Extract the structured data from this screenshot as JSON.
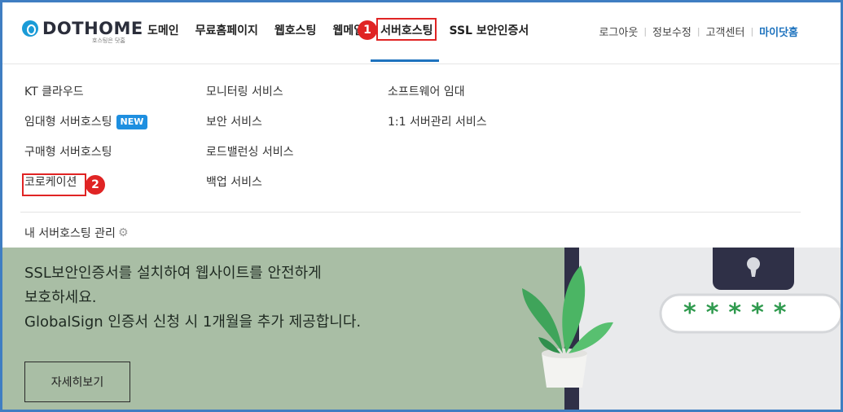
{
  "logo": {
    "name": "DOTHOME",
    "tagline": "호스팅은 닷홈"
  },
  "gnb": [
    {
      "label": "도메인"
    },
    {
      "label": "무료홈페이지"
    },
    {
      "label": "웹호스팅"
    },
    {
      "label": "웹메일"
    },
    {
      "label": "서버호스팅"
    },
    {
      "label": "SSL 보안인증서"
    }
  ],
  "util": [
    {
      "label": "로그아웃"
    },
    {
      "label": "정보수정"
    },
    {
      "label": "고객센터"
    },
    {
      "label": "마이닷홈"
    }
  ],
  "annotations": {
    "step1": "1",
    "step2": "2",
    "accent": "#e02424"
  },
  "dropdown": {
    "col1": [
      "KT 클라우드",
      "임대형 서버호스팅",
      "구매형 서버호스팅",
      "코로케이션"
    ],
    "new_badge": "NEW",
    "col2": [
      "모니터링 서비스",
      "보안 서비스",
      "로드밸런싱 서비스",
      "백업 서비스"
    ],
    "col3": [
      "소프트웨어 임대",
      "1:1 서버관리 서비스"
    ],
    "manage_label": "내 서버호스팅 관리"
  },
  "banner": {
    "line1": "SSL보안인증서를 설치하여 웹사이트를 안전하게",
    "line2": "보호하세요.",
    "line3": "GlobalSign 인증서 신청 시 1개월을 추가 제공합니다.",
    "button_label": "자세히보기",
    "password_mask": "*****"
  },
  "colors": {
    "brand": "#1e73be",
    "border": "#3f7ec2",
    "banner_bg": "#a9bea5",
    "new_badge": "#1e8fe0"
  }
}
